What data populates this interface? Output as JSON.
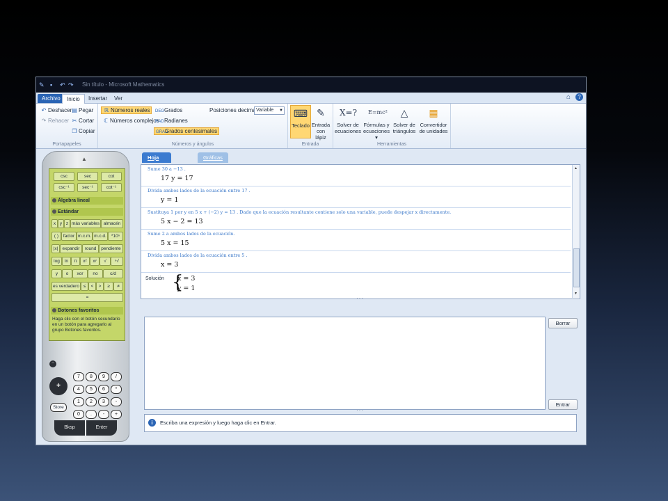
{
  "titlebar": {
    "title": "Sin título - Microsoft Mathematics"
  },
  "menu": {
    "archivo": "Archivo",
    "inicio": "Inicio",
    "insertar": "Insertar",
    "ver": "Ver"
  },
  "ribbon": {
    "portapapeles": {
      "deshacer": "Deshacer",
      "rehacer": "Rehacer",
      "pegar": "Pegar",
      "cortar": "Cortar",
      "copiar": "Copiar",
      "label": "Portapapeles"
    },
    "numeros": {
      "reales": "Números reales",
      "complejos": "Números complejos",
      "grados": "Grados",
      "radianes": "Radianes",
      "centesimales": "Grados centesimales",
      "posiciones": "Posiciones decimales",
      "select_value": "Variable",
      "label": "Números y ángulos"
    },
    "entrada": {
      "teclado": "Teclado",
      "lapiz_1": "Entrada",
      "lapiz_2": "con lápiz",
      "label": "Entrada"
    },
    "herramientas": {
      "solver_1": "Solver de",
      "solver_2": "ecuaciones",
      "formulas_1": "Fórmulas y",
      "formulas_2": "ecuaciones ▾",
      "triangulos_1": "Solver de",
      "triangulos_2": "triángulos",
      "conv_1": "Convertidor",
      "conv_2": "de unidades",
      "label": "Herramientas"
    }
  },
  "calculator": {
    "trig_row1": [
      "csc",
      "sec",
      "cot"
    ],
    "trig_row2": [
      "csc⁻¹",
      "sec⁻¹",
      "cot⁻¹"
    ],
    "section_algebra": "Álgebra lineal",
    "section_estandar": "Estándar",
    "std_row1": [
      "x",
      "y",
      "z",
      "más variables",
      "almacén"
    ],
    "std_row2": [
      "( )",
      "factor",
      "m.c.m.",
      "m.c.d.",
      "*10ⁿ"
    ],
    "std_row3": [
      "|x|",
      "expandir",
      "round",
      "pendiente"
    ],
    "std_row4": [
      "log",
      "ln",
      "π",
      "x²",
      "xʸ",
      "√",
      "ⁿ√"
    ],
    "std_row5": [
      "y",
      "o",
      "xor",
      "no",
      "c/d"
    ],
    "std_row6": [
      "es verdadero",
      "≤",
      "<",
      ">",
      "≥",
      "≠"
    ],
    "std_row7": "=",
    "section_fav": "Botones favoritos",
    "fav_text": "Haga clic con el botón secundario en un botón para agregarlo al grupo Botones favoritos.",
    "num_rows": [
      [
        "7",
        "8",
        "9",
        "/"
      ],
      [
        "4",
        "5",
        "6",
        "*"
      ],
      [
        "1",
        "2",
        "3",
        "-"
      ],
      [
        "0",
        ".",
        "-",
        "+"
      ]
    ],
    "store": "Store",
    "bksp": "Bksp",
    "enter": "Enter"
  },
  "worksheet": {
    "tabs": {
      "hoja": "Hoja de cálculo",
      "graficas": "Gráficas"
    },
    "steps": [
      {
        "desc": "Sume  30  a  −13 .",
        "expr": "17 y = 17"
      },
      {
        "desc": "Divida ambos lados de la ecuación entre  17 .",
        "expr": "y = 1"
      },
      {
        "desc": "Sustituya  1  por  y  en  5 x + (−2) y = 13 . Dado que la ecuación resultante contiene solo una variable, puede despejar  x  directamente.",
        "expr": "5 x − 2 = 13"
      },
      {
        "desc": "Sume  2  a ambos lados de la ecuación.",
        "expr": "5 x = 15"
      },
      {
        "desc": "Divida ambos lados de la ecuación entre  5 .",
        "expr": "x = 3"
      }
    ],
    "solution_label": "Solución",
    "solution": [
      "x = 3",
      "y = 1"
    ]
  },
  "input": {
    "borrar": "Borrar",
    "entrar": "Entrar"
  },
  "status": {
    "text": "Escriba una expresión y luego haga clic en Entrar."
  }
}
